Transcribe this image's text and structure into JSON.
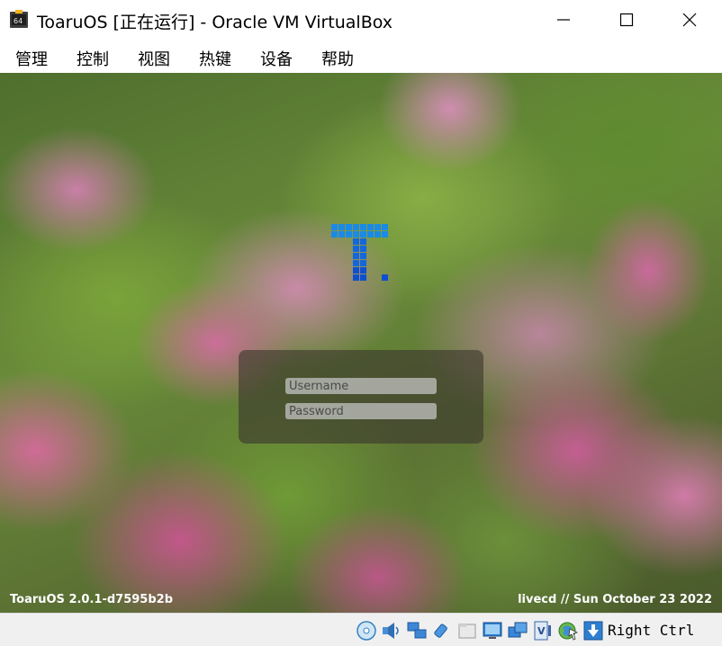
{
  "window": {
    "title": "ToaruOS [正在运行] - Oracle VM VirtualBox",
    "app_icon": "virtualbox-icon",
    "controls": [
      "minimize-icon",
      "maximize-icon",
      "close-icon"
    ]
  },
  "menubar": {
    "items": [
      {
        "label": "管理"
      },
      {
        "label": "控制"
      },
      {
        "label": "视图"
      },
      {
        "label": "热键"
      },
      {
        "label": "设备"
      },
      {
        "label": "帮助"
      }
    ]
  },
  "vm": {
    "logo": "toaruos-logo",
    "login": {
      "username_placeholder": "Username",
      "password_placeholder": "Password"
    },
    "footer_left": "ToaruOS 2.0.1-d7595b2b",
    "footer_right": "livecd // Sun October 23 2022"
  },
  "statusbar": {
    "icons": [
      "optical-drive-icon",
      "audio-icon",
      "network-icon",
      "usb-icon",
      "shared-folders-icon",
      "display-icon",
      "video-capture-icon",
      "virtualization-icon",
      "mouse-integration-icon",
      "keyboard-capture-icon"
    ],
    "host_key": "Right Ctrl"
  },
  "colors": {
    "accent_blue": "#1a7fe0",
    "panel": "#3c372d"
  }
}
